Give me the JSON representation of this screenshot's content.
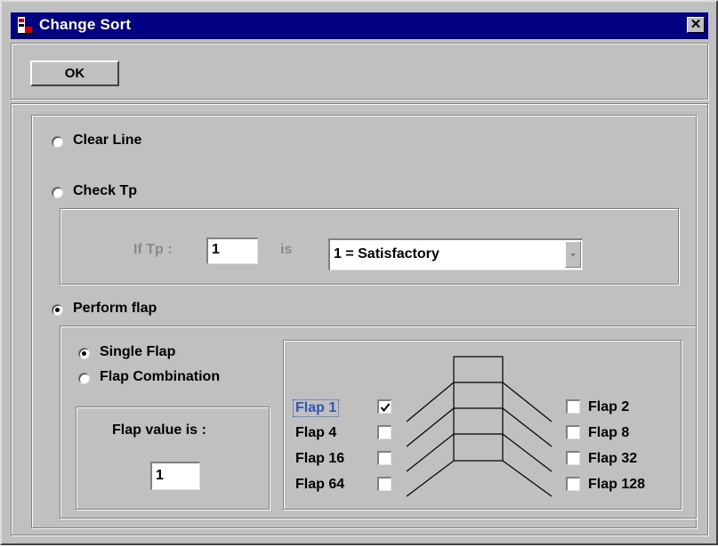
{
  "window": {
    "title": "Change Sort"
  },
  "toolbar": {
    "ok_label": "OK"
  },
  "options": {
    "clear_line": "Clear Line",
    "check_tp": "Check Tp",
    "perform_flap": "Perform flap",
    "selected": "Perform flap"
  },
  "check_tp_group": {
    "if_tp_label": "If Tp :",
    "tp_value": "1",
    "is_label": "is",
    "result_selected": "1 = Satisfactory"
  },
  "flap_mode": {
    "single": "Single Flap",
    "combination": "Flap Combination",
    "selected": "Single Flap"
  },
  "flap_value": {
    "label": "Flap value is :",
    "value": "1"
  },
  "flaps_left": [
    {
      "label": "Flap 1",
      "checked": true
    },
    {
      "label": "Flap 4",
      "checked": false
    },
    {
      "label": "Flap 16",
      "checked": false
    },
    {
      "label": "Flap 64",
      "checked": false
    }
  ],
  "flaps_right": [
    {
      "label": "Flap 2",
      "checked": false
    },
    {
      "label": "Flap 8",
      "checked": false
    },
    {
      "label": "Flap 32",
      "checked": false
    },
    {
      "label": "Flap 128",
      "checked": false
    }
  ],
  "colors": {
    "titlebar": "#000080",
    "face": "#c0c0c0",
    "focus_text": "#3355bb"
  }
}
